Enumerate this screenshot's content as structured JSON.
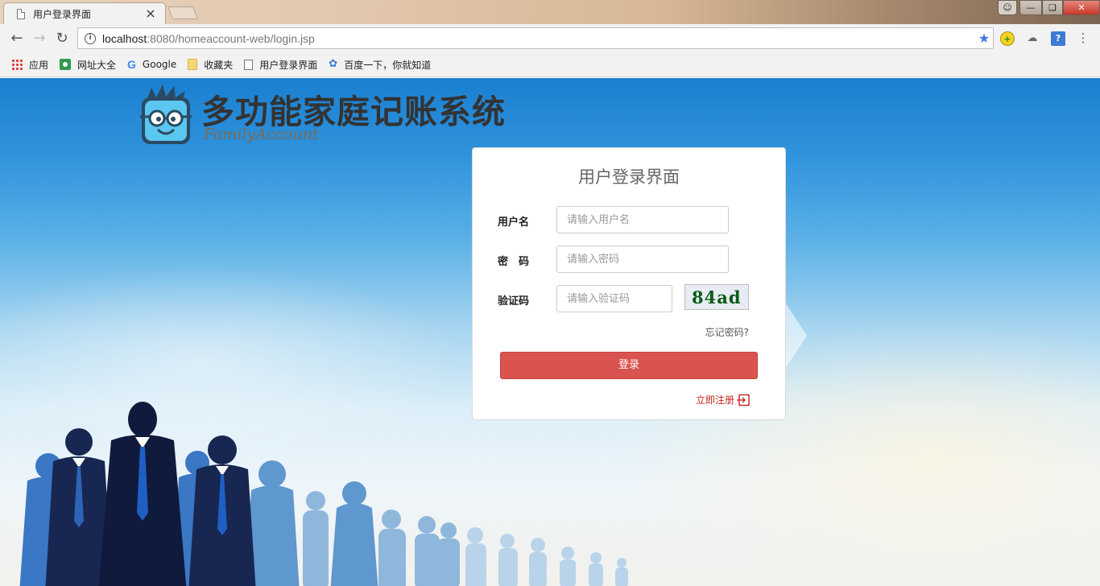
{
  "browser": {
    "tab": {
      "title": "用户登录界面"
    },
    "url": {
      "host": "localhost",
      "rest": ":8080/homeaccount-web/login.jsp"
    },
    "bookmarks": [
      {
        "label": "应用",
        "icon": "apps-grid-icon"
      },
      {
        "label": "网址大全",
        "icon": "web-directory-icon"
      },
      {
        "label": "Google",
        "icon": "google-icon"
      },
      {
        "label": "收藏夹",
        "icon": "folder-icon"
      },
      {
        "label": "用户登录界面",
        "icon": "page-icon"
      },
      {
        "label": "百度一下，你就知道",
        "icon": "baidu-paw-icon"
      }
    ]
  },
  "site": {
    "title": "多功能家庭记账系统",
    "subtitle": "FamilyAccount"
  },
  "login": {
    "title": "用户登录界面",
    "username_label": "用户名",
    "username_placeholder": "请输入用户名",
    "password_label": "密　码",
    "password_placeholder": "请输入密码",
    "captcha_label": "验证码",
    "captcha_placeholder": "请输入验证码",
    "captcha_text": "84ad",
    "forgot_label": "忘记密码?",
    "login_button": "登录",
    "register_label": "立即注册"
  },
  "colors": {
    "login_button": "#d9534f",
    "register_link": "#c0261e",
    "sky_top": "#1a7fd0"
  }
}
